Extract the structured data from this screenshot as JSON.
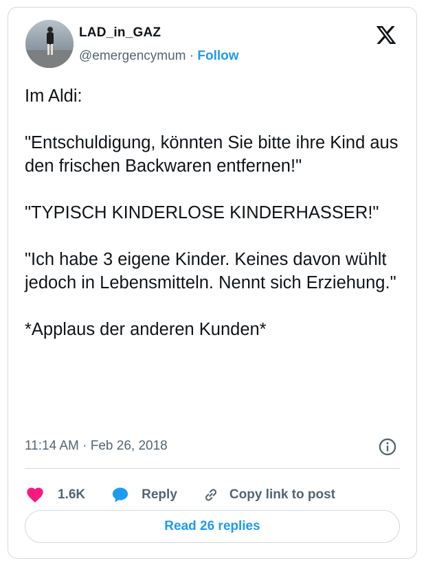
{
  "author": {
    "display_name": "LAD_in_GAZ",
    "handle": "@emergencymum",
    "separator": "·",
    "follow_label": "Follow"
  },
  "tweet": {
    "text": "Im Aldi:\n\n\"Entschuldigung, könnten Sie bitte ihre Kind aus den frischen Backwaren entfernen!\"\n\n\"TYPISCH KINDERLOSE KINDERHASSER!\"\n\n\"Ich habe 3 eigene Kinder. Keines davon wühlt jedoch in Lebensmitteln. Nennt sich Erziehung.\"\n\n*Applaus der anderen Kunden*",
    "timestamp": "11:14 AM · Feb 26, 2018"
  },
  "actions": {
    "like_count": "1.6K",
    "reply_label": "Reply",
    "copy_link_label": "Copy link to post"
  },
  "read_replies_label": "Read 26 replies",
  "icons": {
    "logo": "x-logo-icon",
    "info": "info-icon",
    "like": "heart-icon",
    "reply": "speech-bubble-icon",
    "copy": "link-icon"
  },
  "colors": {
    "accent": "#1d9bf0",
    "heart": "#f91880",
    "text": "#0f1419",
    "secondary": "#536471",
    "border": "#cfd9de"
  }
}
